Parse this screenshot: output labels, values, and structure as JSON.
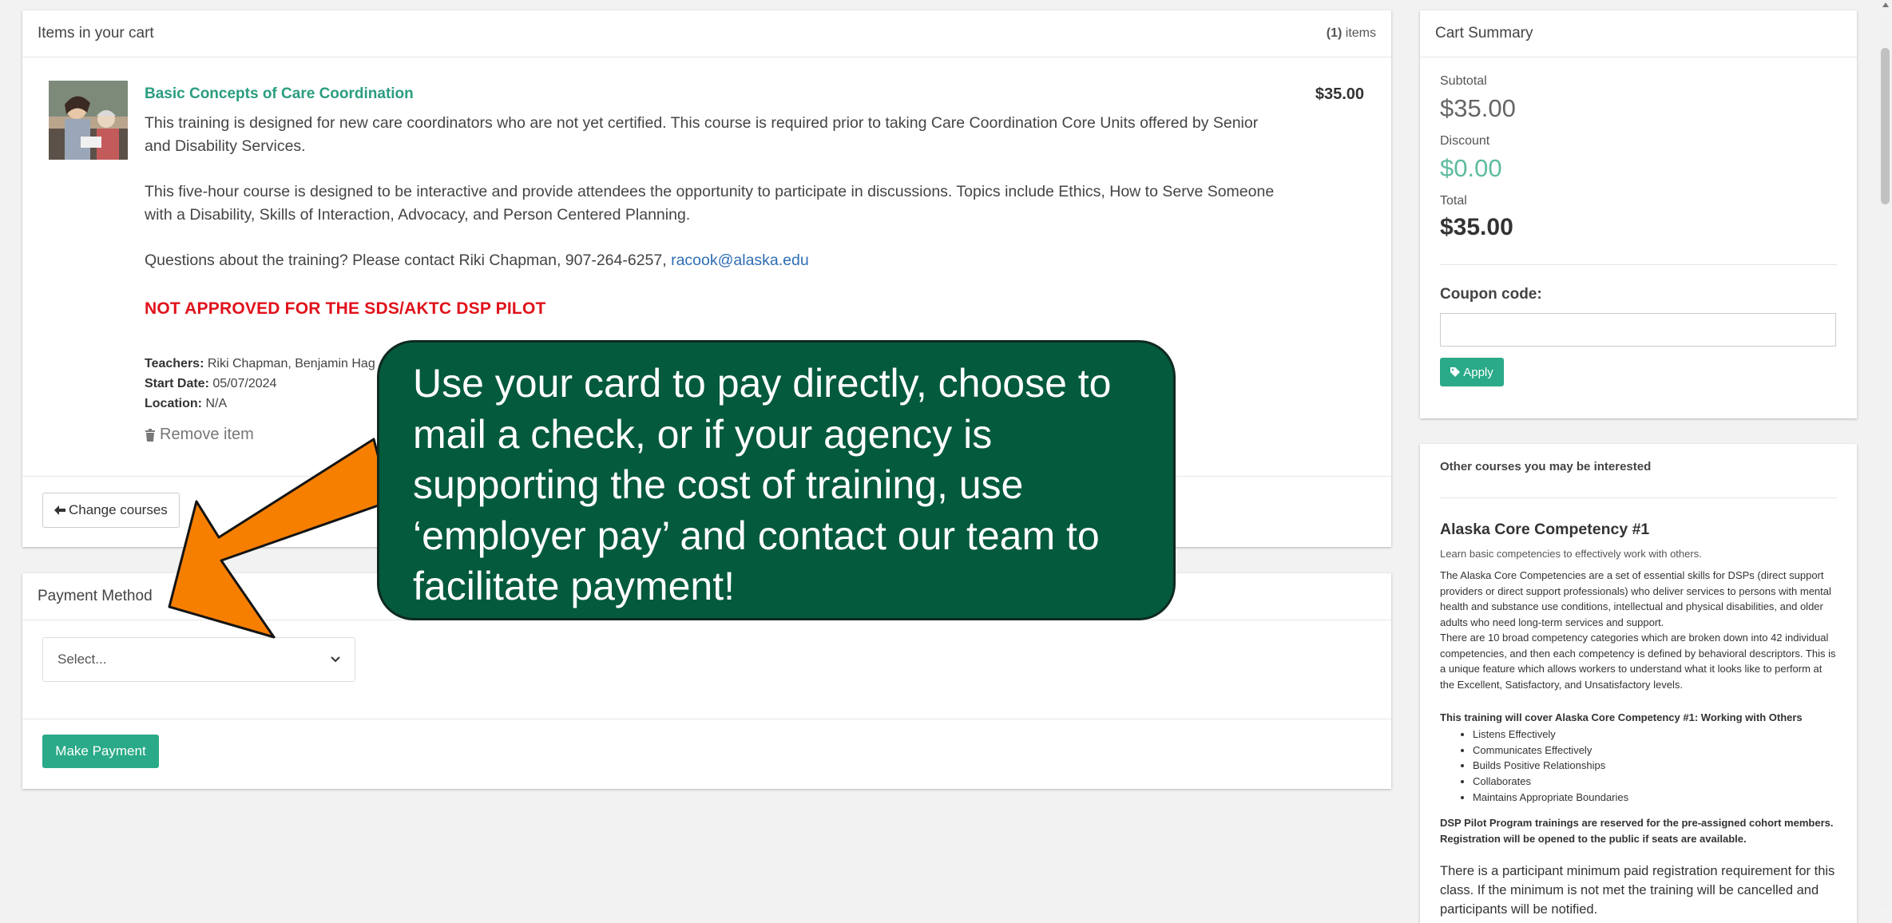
{
  "cart": {
    "header": "Items in your cart",
    "count_number": "(1)",
    "count_suffix": " items",
    "item": {
      "title": "Basic Concepts of Care Coordination",
      "price": "$35.00",
      "desc1": "This training is designed for new care coordinators who are not yet certified. This course is required prior to taking Care Coordination Core Units offered by Senior and Disability Services.",
      "desc2": "This five-hour course is designed to be interactive and provide attendees the opportunity to participate in discussions. Topics include Ethics, How to Serve Someone with a Disability, Skills of Interaction, Advocacy, and Person Centered Planning.",
      "questions": "Questions about the training? Please contact Riki Chapman, 907-264-6257, ",
      "email": "racook@alaska.edu",
      "warning": "NOT APPROVED FOR THE SDS/AKTC DSP PILOT",
      "teachers_label": "Teachers:",
      "teachers": " Riki Chapman, Benjamin Hag",
      "start_label": "Start Date:",
      "start": " 05/07/2024",
      "location_label": "Location:",
      "location": " N/A",
      "remove": "Remove item",
      "thumbnail_icon": "photo-thumbnail"
    },
    "change_courses": "Change courses"
  },
  "payment": {
    "header": "Payment Method",
    "select_value": "Select...",
    "make_payment": "Make Payment"
  },
  "summary": {
    "header": "Cart Summary",
    "subtotal_label": "Subtotal",
    "subtotal": "$35.00",
    "discount_label": "Discount",
    "discount": "$0.00",
    "total_label": "Total",
    "total": "$35.00",
    "coupon_label": "Coupon code:",
    "coupon_value": "",
    "apply": "Apply"
  },
  "other": {
    "header": "Other courses you may be interested",
    "title": "Alaska Core Competency #1",
    "subtitle": "Learn basic competencies to effectively work with others.",
    "para1": "The Alaska Core Competencies are a set of essential skills for DSPs (direct support providers or direct support professionals) who deliver services to persons with mental health and substance use conditions, intellectual and physical disabilities, and older adults who need long-term services and support.",
    "para2": "There are 10 broad competency categories which are broken down into 42 individual competencies, and then each competency is defined by behavioral descriptors. This is a unique feature which allows workers to understand what it looks like to perform at the Excellent, Satisfactory, and Unsatisfactory levels.",
    "cover": "This training will cover Alaska Core Competency #1: Working with Others",
    "list": [
      "Listens Effectively",
      "Communicates Effectively",
      "Builds Positive Relationships",
      "Collaborates",
      "Maintains Appropriate Boundaries"
    ],
    "pilot": "DSP Pilot Program trainings are reserved for the pre-assigned cohort members. Registration will be opened to the public if seats are available.",
    "final": "There is a participant minimum paid registration requirement for this class. If the minimum is not met the training will be cancelled and participants will be notified."
  },
  "callout": {
    "text": "Use your card to pay directly, choose to mail a check, or if your agency is supporting the cost of training, use ‘employer pay’ and contact our team to facilitate payment!"
  },
  "colors": {
    "accent": "#2aaa88",
    "callout_bg": "#045a3c",
    "arrow": "#f77f00",
    "warning": "#e0121b"
  }
}
